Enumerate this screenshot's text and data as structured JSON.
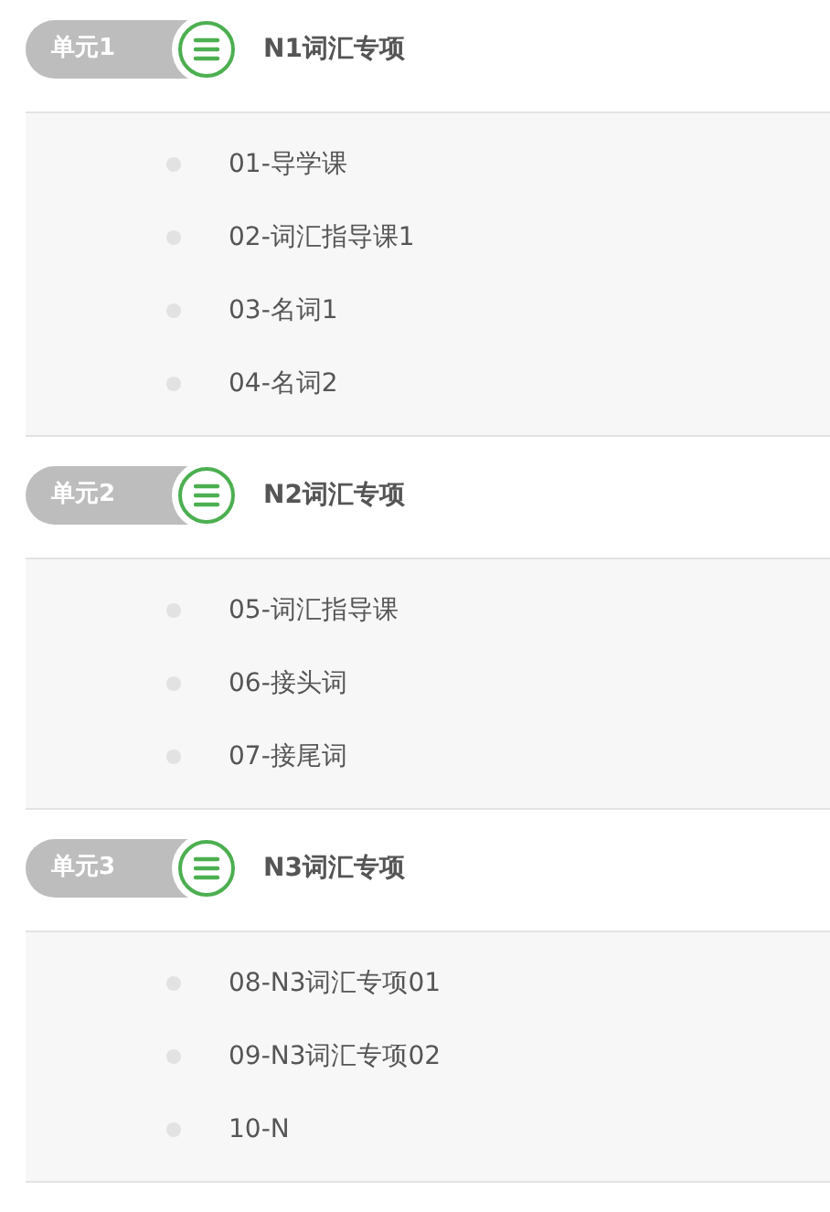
{
  "units": [
    {
      "label": "单元1",
      "title": "N1词汇专项",
      "lessons": [
        "01-导学课",
        "02-词汇指导课1",
        "03-名词1",
        "04-名词2"
      ]
    },
    {
      "label": "单元2",
      "title": "N2词汇专项",
      "lessons": [
        "05-词汇指导课",
        "06-接头词",
        "07-接尾词"
      ]
    },
    {
      "label": "单元3",
      "title": "N3词汇专项",
      "lessons": [
        "08-N3词汇专项01",
        "09-N3词汇专项02",
        "10-N"
      ]
    }
  ]
}
